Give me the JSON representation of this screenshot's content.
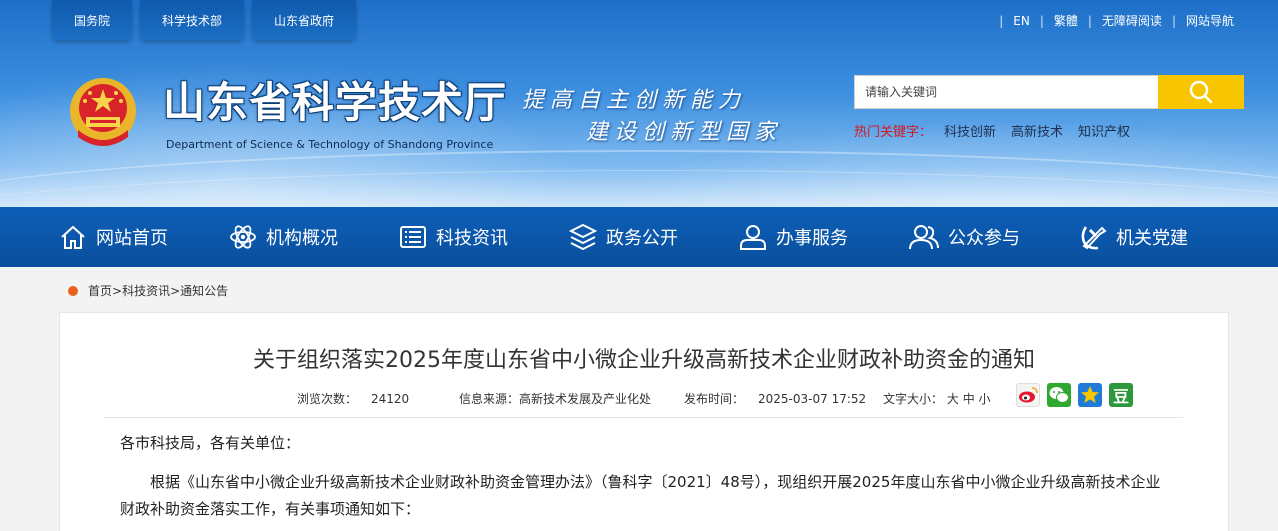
{
  "top_links": [
    "国务院",
    "科学技术部",
    "山东省政府"
  ],
  "util_links": [
    "EN",
    "繁體",
    "无障碍阅读",
    "网站导航"
  ],
  "site": {
    "title": "山东省科学技术厅",
    "subtitle": "Department of Science & Technology of Shandong Province",
    "slogan_line1": "提高自主创新能力",
    "slogan_line2": "建设创新型国家"
  },
  "search": {
    "placeholder": "请输入关键词"
  },
  "hot": {
    "label": "热门关键字：",
    "words": [
      "科技创新",
      "高新技术",
      "知识产权"
    ]
  },
  "nav": [
    {
      "label": "网站首页",
      "icon": "home-icon"
    },
    {
      "label": "机构概况",
      "icon": "atom-icon"
    },
    {
      "label": "科技资讯",
      "icon": "news-icon"
    },
    {
      "label": "政务公开",
      "icon": "layers-icon"
    },
    {
      "label": "办事服务",
      "icon": "user-service-icon"
    },
    {
      "label": "公众参与",
      "icon": "people-icon"
    },
    {
      "label": "机关党建",
      "icon": "party-emblem-icon"
    }
  ],
  "breadcrumb": [
    "首页",
    "科技资讯",
    "通知公告"
  ],
  "article": {
    "title": "关于组织落实2025年度山东省中小微企业升级高新技术企业财政补助资金的通知",
    "views_label": "浏览次数：",
    "views": "24120",
    "source_label": "信息来源：",
    "source": "高新技术发展及产业化处",
    "date_label": "发布时间：",
    "date": "2025-03-07 17:52",
    "font_label": "文字大小：",
    "font_sizes": [
      "大",
      "中",
      "小"
    ],
    "share": [
      {
        "name": "weibo",
        "color": "#f4f4f4"
      },
      {
        "name": "wechat",
        "color": "#2ea82e"
      },
      {
        "name": "qzone",
        "color": "#f7b500"
      },
      {
        "name": "douban",
        "color": "#2e963d"
      }
    ],
    "salutation": "各市科技局，各有关单位：",
    "para1": "根据《山东省中小微企业升级高新技术企业财政补助资金管理办法》（鲁科字〔2021〕48号），现组织开展2025年度山东省中小微企业升级高新技术企业财政补助资金落实工作，有关事项通知如下："
  }
}
